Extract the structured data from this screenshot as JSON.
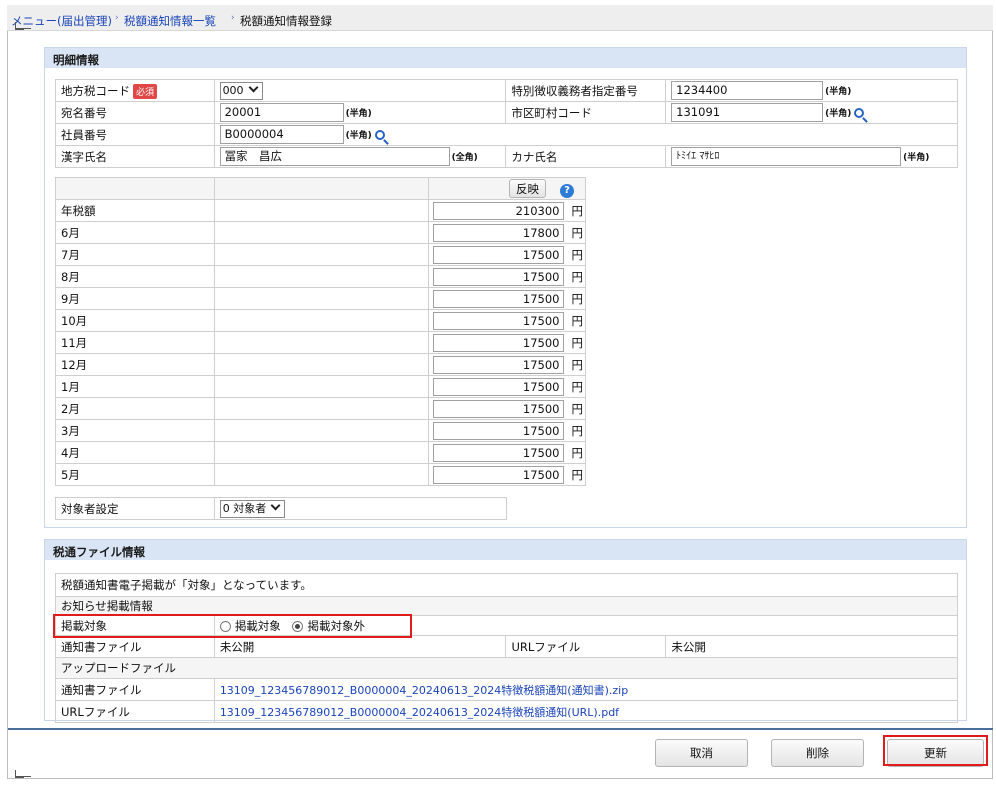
{
  "breadcrumb": {
    "menu": "メニュー(届出管理)",
    "list": "税額通知情報一覧",
    "current": "税額通知情報登録"
  },
  "detail": {
    "title": "明細情報",
    "tax_code_label": "地方税コード",
    "required_badge": "必須",
    "tax_code_value": "000",
    "designation_label": "特別徴収義務者指定番号",
    "designation_value": "1234400",
    "address_no_label": "宛名番号",
    "address_no_value": "20001",
    "city_code_label": "市区町村コード",
    "city_code_value": "131091",
    "employee_no_label": "社員番号",
    "employee_no_value": "B0000004",
    "kanji_label": "漢字氏名",
    "kanji_value": "冨家　昌広",
    "kana_label": "カナ氏名",
    "kana_value": "ﾄﾐｲｴ ﾏｻﾋﾛ",
    "half_width": "(半角)",
    "full_width": "(全角)"
  },
  "monthly": {
    "reflect_button": "反映",
    "help_icon": "?",
    "currency": "円",
    "rows": [
      {
        "label": "年税額",
        "value": "210300"
      },
      {
        "label": "6月",
        "value": "17800"
      },
      {
        "label": "7月",
        "value": "17500"
      },
      {
        "label": "8月",
        "value": "17500"
      },
      {
        "label": "9月",
        "value": "17500"
      },
      {
        "label": "10月",
        "value": "17500"
      },
      {
        "label": "11月",
        "value": "17500"
      },
      {
        "label": "12月",
        "value": "17500"
      },
      {
        "label": "1月",
        "value": "17500"
      },
      {
        "label": "2月",
        "value": "17500"
      },
      {
        "label": "3月",
        "value": "17500"
      },
      {
        "label": "4月",
        "value": "17500"
      },
      {
        "label": "5月",
        "value": "17500"
      }
    ]
  },
  "target": {
    "label": "対象者設定",
    "value": "0 対象者"
  },
  "file_info": {
    "title": "税通ファイル情報",
    "message": "税額通知書電子掲載が「対象」となっています。",
    "notice_header": "お知らせ掲載情報",
    "publish_label": "掲載対象",
    "radio_on": "掲載対象",
    "radio_off": "掲載対象外",
    "notice_file_label": "通知書ファイル",
    "notice_file_status": "未公開",
    "url_file_label": "URLファイル",
    "url_file_status": "未公開",
    "upload_header": "アップロードファイル",
    "upload_notice_label": "通知書ファイル",
    "upload_notice_link": "13109_123456789012_B0000004_20240613_2024特徴税額通知(通知書).zip",
    "upload_url_label": "URLファイル",
    "upload_url_link": "13109_123456789012_B0000004_20240613_2024特徴税額通知(URL).pdf"
  },
  "footer": {
    "cancel": "取消",
    "delete": "削除",
    "update": "更新"
  },
  "colors": {
    "panel_header": "#d9e5f4",
    "link": "#1a44b8",
    "highlight": "#e01b1b"
  }
}
